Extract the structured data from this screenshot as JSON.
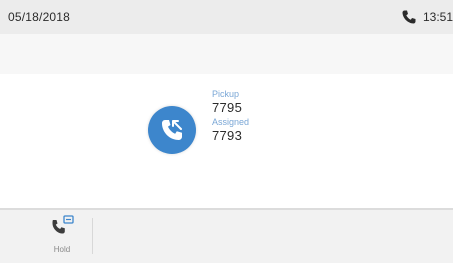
{
  "statusbar": {
    "date": "05/18/2018",
    "time": "13:51",
    "phone_icon": "phone-icon"
  },
  "call": {
    "from_label": "Pickup",
    "from_number": "7795",
    "to_label": "Assigned",
    "to_number": "7793",
    "avatar_icon": "incoming-call-icon"
  },
  "softkeys": [
    {
      "label": "Hold",
      "icon": "call-transfer-icon"
    }
  ],
  "colors": {
    "accent": "#3d86cc",
    "statusbar_bg": "#ececec"
  }
}
